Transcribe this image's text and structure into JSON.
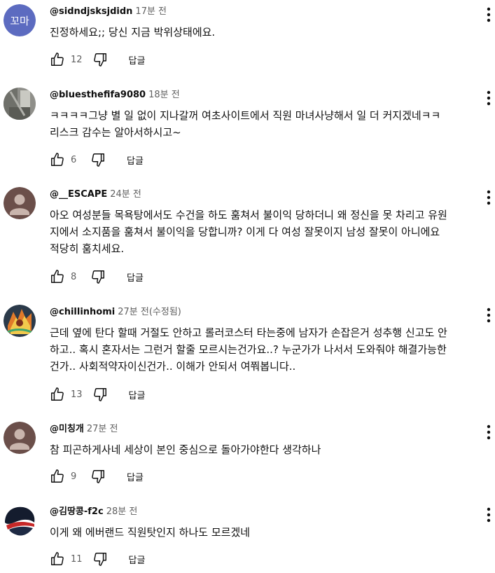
{
  "reply_label": "답글",
  "colors": {
    "author": "#0f0f0f",
    "meta": "#606060",
    "avatar_initials_bg": "#5c6bc0"
  },
  "comments": [
    {
      "author": "@sidndjsksjdidn",
      "time": "17분 전",
      "avatar": {
        "type": "initials",
        "text": "꼬마"
      },
      "lines": [
        "진정하세요;; 당신 지금 박위상태에요."
      ],
      "likes": "12"
    },
    {
      "author": "@bluesthefifa9080",
      "time": "18분 전",
      "avatar": {
        "type": "photo"
      },
      "lines": [
        "ㅋㅋㅋㅋ그냥 별 일 없이 지나갈꺼 여초사이트에서 직원 마녀사냥해서 일 더 커지겠네ㅋㅋ",
        "리스크 감수는 알아서하시고~"
      ],
      "likes": "6"
    },
    {
      "author": "@__ESCAPE",
      "time": "24분 전",
      "avatar": {
        "type": "default"
      },
      "lines": [
        "아오 여성분들 목욕탕에서도 수건을 하도 훔쳐서 불이익 당하더니 왜 정신을 못 차리고 유원",
        "지에서 소지품을 훔쳐서 불이익을 당합니까? 이게 다 여성 잘못이지 남성 잘못이 아니에요",
        "적당히 훔치세요."
      ],
      "likes": "8"
    },
    {
      "author": "@chillinhomi",
      "time": "27분 전(수정됨)",
      "avatar": {
        "type": "art"
      },
      "lines": [
        "근데 옆에 탄다 할때 거절도 안하고 롤러코스터 타는중에 남자가 손잡은거 성추행 신고도 안",
        "하고.. 혹시 혼자서는 그런거 할줄 모르시는건가요..? 누군가가 나서서 도와줘야 해결가능한",
        "건가.. 사회적약자이신건가.. 이해가 안되서 여쭤봅니다.."
      ],
      "likes": "13"
    },
    {
      "author": "@미칭개",
      "time": "27분 전",
      "avatar": {
        "type": "default"
      },
      "lines": [
        "참 피곤하게사네 세상이 본인 중심으로 돌아가야한다 생각하나"
      ],
      "likes": "9"
    },
    {
      "author": "@김땅콩-f2c",
      "time": "28분 전",
      "avatar": {
        "type": "helmet"
      },
      "lines": [
        "이게 왜 에버랜드 직원탓인지 하나도 모르겠네"
      ],
      "likes": "11"
    }
  ]
}
